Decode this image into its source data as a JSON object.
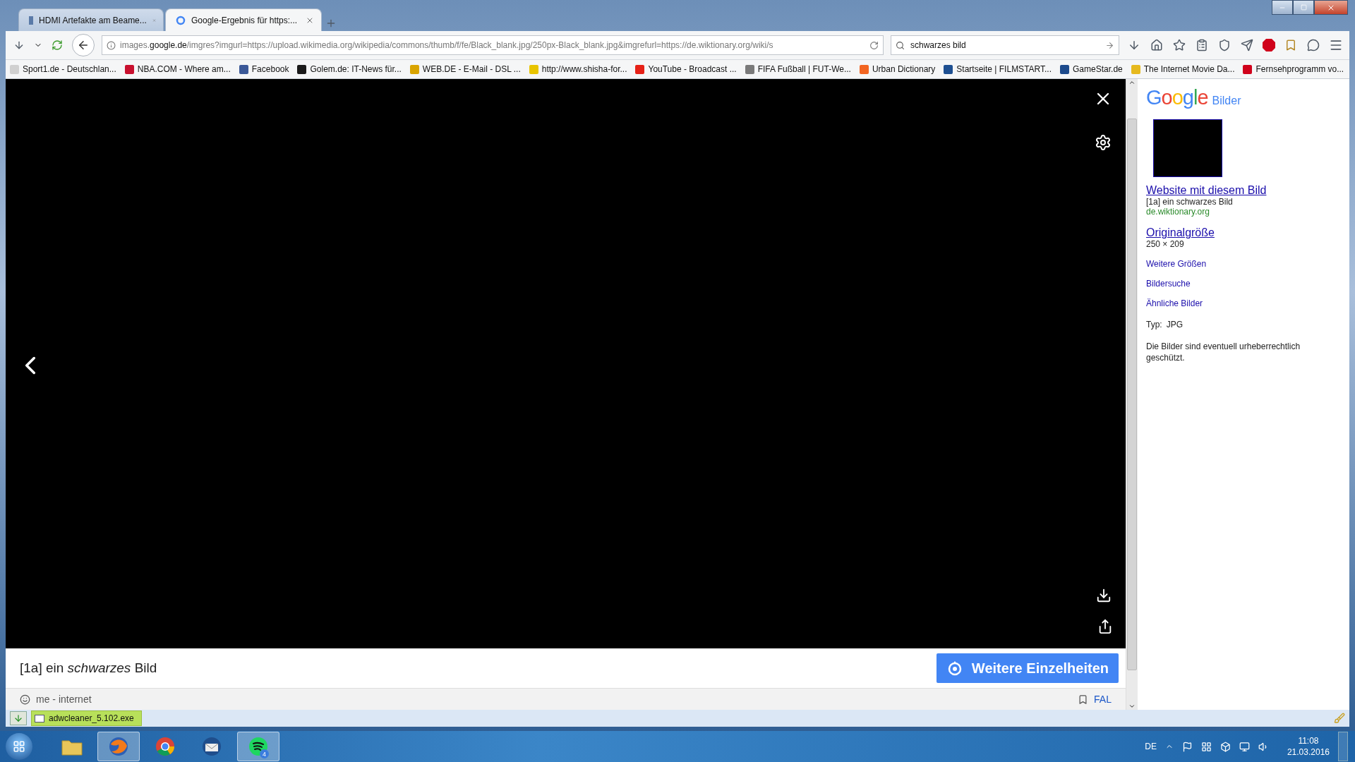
{
  "tabs": [
    {
      "label": "HDMI Artefakte am Beame...",
      "selected": false
    },
    {
      "label": "Google-Ergebnis für https:...",
      "selected": true
    }
  ],
  "address": "images.**google.de**/imgres?imgurl=https://upload.wikimedia.org/wikipedia/commons/thumb/f/fe/Black_blank.jpg/250px-Black_blank.jpg&imgrefurl=https://de.wiktionary.org/wiki/s",
  "search": {
    "value": "schwarzes bild"
  },
  "bookmarks": [
    {
      "label": "Sport1.de - Deutschlan...",
      "color": "#d0d0d0"
    },
    {
      "label": "NBA.COM - Where am...",
      "color": "#c8102e"
    },
    {
      "label": "Facebook",
      "color": "#3b5998"
    },
    {
      "label": "Golem.de: IT-News für...",
      "color": "#1a1a1a"
    },
    {
      "label": "WEB.DE - E-Mail - DSL ...",
      "color": "#d9a400"
    },
    {
      "label": "http://www.shisha-for...",
      "color": "#e8c400"
    },
    {
      "label": "YouTube - Broadcast ...",
      "color": "#e62117"
    },
    {
      "label": "FIFA Fußball | FUT-We...",
      "color": "#7a7a7a"
    },
    {
      "label": "Urban Dictionary",
      "color": "#f26522"
    },
    {
      "label": "Startseite | FILMSTART...",
      "color": "#1d4f91"
    },
    {
      "label": "GameStar.de",
      "color": "#1c4a8c"
    },
    {
      "label": "The Internet Movie Da...",
      "color": "#e6b91e"
    },
    {
      "label": "Fernsehprogramm vo...",
      "color": "#d0021b"
    }
  ],
  "viewer": {
    "caption": "[1a] ein *schwarzes* Bild",
    "details_button": "Weitere Einzelheiten",
    "source": "me - internet",
    "license": "FAL"
  },
  "panel": {
    "logo": "Google",
    "logo_sub": "Bilder",
    "site_link": "Website mit diesem Bild",
    "description": "[1a] ein schwarzes Bild",
    "domain": "de.wiktionary.org",
    "size_link": "Originalgröße",
    "dimensions": "250 × 209",
    "links": [
      "Weitere Größen",
      "Bildersuche",
      "Ähnliche Bilder"
    ],
    "type_label": "Typ:",
    "type_value": "JPG",
    "notice": "Die Bilder sind eventuell urheberrechtlich geschützt."
  },
  "download": {
    "file": "adwcleaner_5.102.exe"
  },
  "taskbar": {
    "apps": [
      {
        "active": false
      },
      {
        "active": true
      },
      {
        "active": false
      },
      {
        "active": false
      },
      {
        "active": true,
        "badge": "4"
      }
    ],
    "language": "DE",
    "time": "11:08",
    "date": "21.03.2016"
  }
}
